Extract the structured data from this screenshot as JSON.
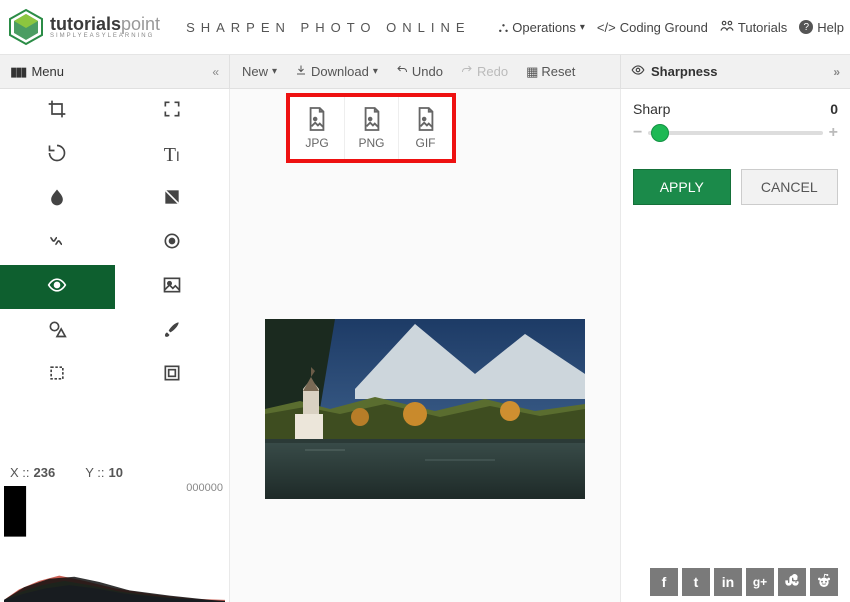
{
  "header": {
    "brand_main": "tutorials",
    "brand_sub": "point",
    "brand_tag": "SIMPLYEASYLEARNING",
    "page_title": "SHARPEN PHOTO ONLINE",
    "nav": {
      "operations": "Operations",
      "coding_ground": "Coding Ground",
      "tutorials": "Tutorials",
      "help": "Help"
    }
  },
  "toolbar": {
    "menu_label": "Menu",
    "new_label": "New",
    "download_label": "Download",
    "undo_label": "Undo",
    "redo_label": "Redo",
    "reset_label": "Reset"
  },
  "download_options": [
    "JPG",
    "PNG",
    "GIF"
  ],
  "sidebar": {
    "tools": [
      {
        "name": "crop",
        "icon": "crop-icon"
      },
      {
        "name": "fullscreen",
        "icon": "fullscreen-icon"
      },
      {
        "name": "rotate",
        "icon": "rotate-icon"
      },
      {
        "name": "text",
        "icon": "text-icon"
      },
      {
        "name": "blur",
        "icon": "drop-icon"
      },
      {
        "name": "exposure",
        "icon": "exposure-icon"
      },
      {
        "name": "vibrate",
        "icon": "vibrate-icon"
      },
      {
        "name": "target",
        "icon": "target-icon"
      },
      {
        "name": "visibility",
        "icon": "eye-icon",
        "active": true
      },
      {
        "name": "image",
        "icon": "image-icon"
      },
      {
        "name": "shapes",
        "icon": "shapes-icon"
      },
      {
        "name": "brush",
        "icon": "brush-icon"
      },
      {
        "name": "frame-dash",
        "icon": "frame-dash-icon"
      },
      {
        "name": "frame",
        "icon": "frame-icon"
      }
    ],
    "coords": {
      "x_label": "X ::",
      "x_value": "236",
      "y_label": "Y ::",
      "y_value": "10"
    },
    "z_value": "000000"
  },
  "right_panel": {
    "title": "Sharpness",
    "slider_label": "Sharp",
    "slider_value": "0",
    "apply": "APPLY",
    "cancel": "CANCEL"
  },
  "social": [
    "facebook",
    "twitter",
    "linkedin",
    "google-plus",
    "stumbleupon",
    "reddit"
  ]
}
